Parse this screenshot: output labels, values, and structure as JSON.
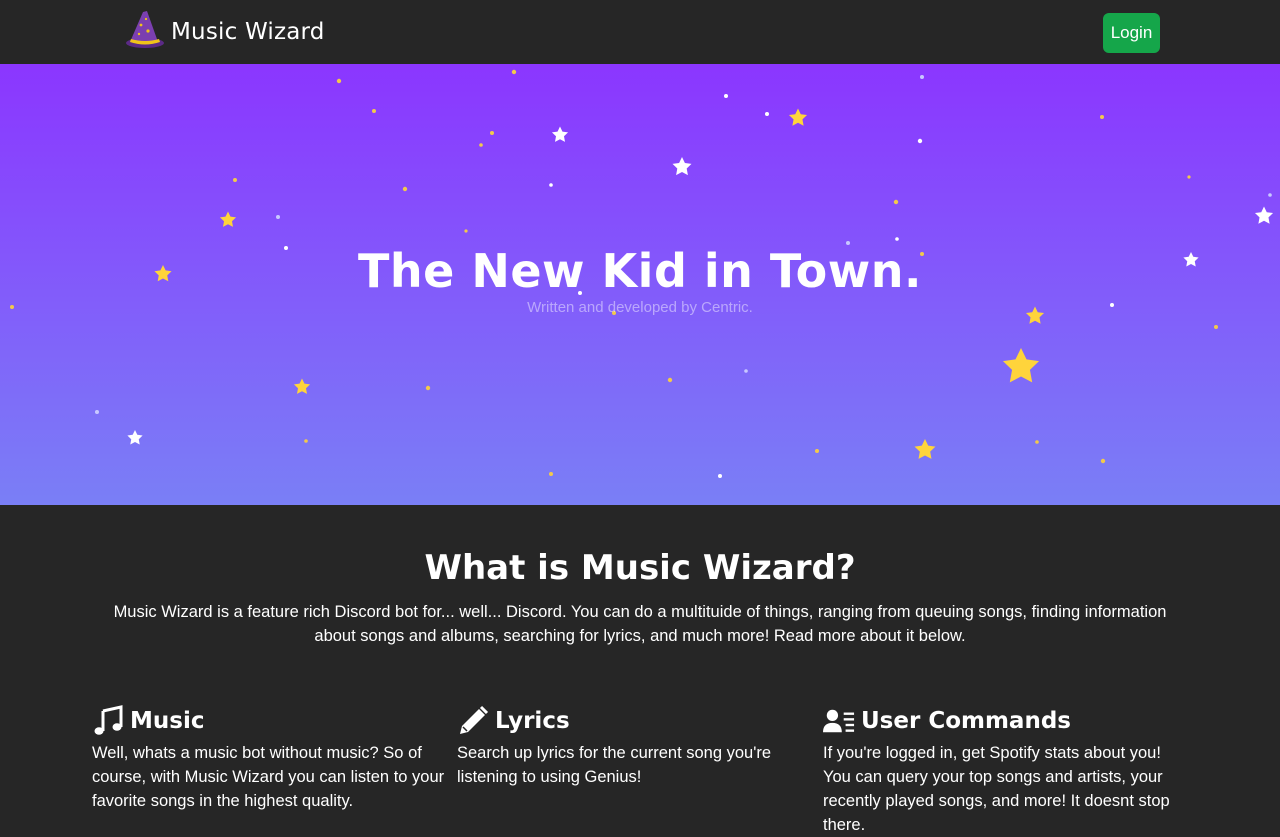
{
  "navbar": {
    "brand_name": "Music Wizard",
    "brand_icon": "wizard-hat-icon",
    "login_label": "Login",
    "login_color": "#15a64a",
    "background": "#262626"
  },
  "hero": {
    "title": "The New Kid in Town.",
    "subtitle": "Written and developed by Centric.",
    "gradient_top": "#8b36ff",
    "gradient_bottom": "#7a7ff6"
  },
  "about": {
    "title": "What is Music Wizard?",
    "text": "Music Wizard is a feature rich Discord bot for... well... Discord. You can do a multituide of things, ranging from queuing songs, finding information about songs and albums, searching for lyrics, and much more! Read more about it below."
  },
  "features": [
    {
      "title": "Music",
      "icon": "music-note-icon",
      "text": "Well, whats a music bot without music? So of course, with Music Wizard you can listen to your favorite songs in the highest quality."
    },
    {
      "title": "Lyrics",
      "icon": "pencil-icon",
      "text": "Search up lyrics for the current song you're listening to using Genius!"
    },
    {
      "title": "User Commands",
      "icon": "user-list-icon",
      "text": "If you're logged in, get Spotify stats about you! You can query your top songs and artists, your recently played songs, and more! It doesnt stop there."
    }
  ]
}
